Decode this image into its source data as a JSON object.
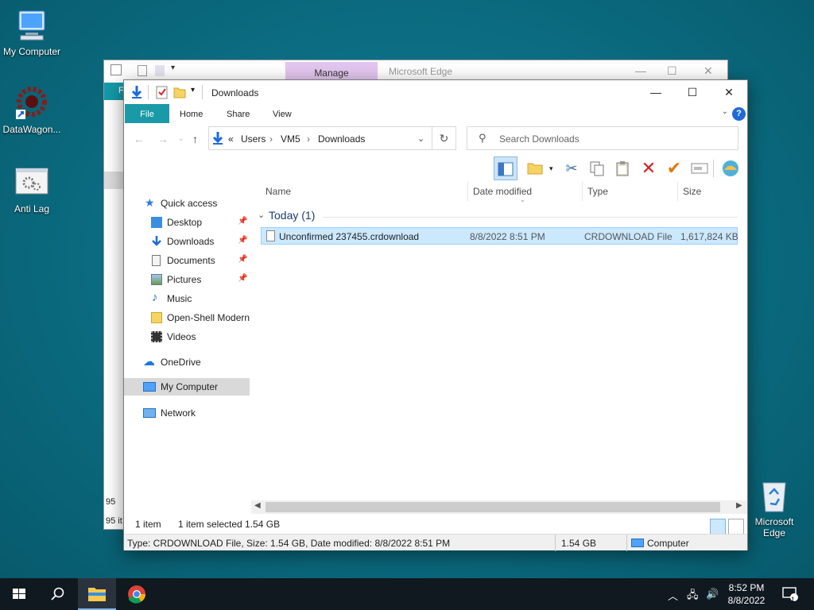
{
  "desktop": {
    "icons": [
      {
        "label": "My Computer"
      },
      {
        "label": "DataWagon..."
      },
      {
        "label": "Anti Lag"
      },
      {
        "label": "Microsoft Edge"
      }
    ]
  },
  "back_window": {
    "manage_label": "Manage",
    "title": "Microsoft Edge",
    "status_count": "95 it",
    "status_num": "95"
  },
  "window": {
    "title": "Downloads",
    "ribbon_tabs": [
      "File",
      "Home",
      "Share",
      "View"
    ],
    "address": {
      "overflow": "«",
      "crumbs": [
        "Users",
        "VM5",
        "Downloads"
      ]
    },
    "search_placeholder": "Search Downloads",
    "nav": {
      "quick_access": "Quick access",
      "items": [
        "Desktop",
        "Downloads",
        "Documents",
        "Pictures",
        "Music",
        "Open-Shell Modern",
        "Videos"
      ],
      "onedrive": "OneDrive",
      "my_computer": "My Computer",
      "network": "Network"
    },
    "columns": [
      "Name",
      "Date modified",
      "Type",
      "Size"
    ],
    "group": "Today (1)",
    "files": [
      {
        "name": "Unconfirmed 237455.crdownload",
        "date": "8/8/2022 8:51 PM",
        "type": "CRDOWNLOAD File",
        "size": "1,617,824 KB"
      }
    ],
    "status": {
      "count": "1 item",
      "selected": "1 item selected  1.54 GB"
    },
    "details": {
      "text": "Type: CRDOWNLOAD File, Size: 1.54 GB, Date modified: 8/8/2022 8:51 PM",
      "size": "1.54 GB",
      "location": "Computer"
    }
  },
  "taskbar": {
    "time": "8:52 PM",
    "date": "8/8/2022",
    "notification_count": "1"
  },
  "colors": {
    "ribbon_file": "#1a9aa6",
    "selection": "#cce8ff",
    "manage_tab": "#e3c6ef",
    "taskbar": "#101820"
  }
}
